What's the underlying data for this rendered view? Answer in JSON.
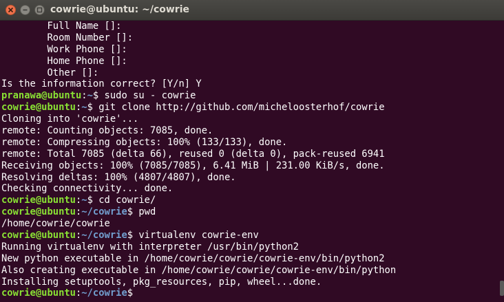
{
  "window": {
    "title": "cowrie@ubuntu: ~/cowrie",
    "buttons": [
      "close-icon",
      "minimize-icon",
      "maximize-icon"
    ]
  },
  "colors": {
    "background": "#300a24",
    "user": "#8ae234",
    "path": "#729fcf",
    "text": "#ffffff"
  },
  "terminal": {
    "lines": [
      {
        "text": "        Full Name []:"
      },
      {
        "text": "        Room Number []:"
      },
      {
        "text": "        Work Phone []:"
      },
      {
        "text": "        Home Phone []:"
      },
      {
        "text": "        Other []:"
      },
      {
        "text": "Is the information correct? [Y/n] Y"
      },
      {
        "user": "pranawa@ubuntu",
        "path": "~",
        "cmd": "$ sudo su - cowrie"
      },
      {
        "user": "cowrie@ubuntu",
        "path": "~",
        "cmd": "$ git clone http://github.com/micheloosterhof/cowrie"
      },
      {
        "text": "Cloning into 'cowrie'..."
      },
      {
        "text": "remote: Counting objects: 7085, done."
      },
      {
        "text": "remote: Compressing objects: 100% (133/133), done."
      },
      {
        "text": "remote: Total 7085 (delta 66), reused 0 (delta 0), pack-reused 6941"
      },
      {
        "text": "Receiving objects: 100% (7085/7085), 6.41 MiB | 231.00 KiB/s, done."
      },
      {
        "text": "Resolving deltas: 100% (4807/4807), done."
      },
      {
        "text": "Checking connectivity... done."
      },
      {
        "user": "cowrie@ubuntu",
        "path": "~",
        "cmd": "$ cd cowrie/"
      },
      {
        "user": "cowrie@ubuntu",
        "path": "~/cowrie",
        "cmd": "$ pwd"
      },
      {
        "text": "/home/cowrie/cowrie"
      },
      {
        "user": "cowrie@ubuntu",
        "path": "~/cowrie",
        "cmd": "$ virtualenv cowrie-env"
      },
      {
        "text": "Running virtualenv with interpreter /usr/bin/python2"
      },
      {
        "text": "New python executable in /home/cowrie/cowrie/cowrie-env/bin/python2"
      },
      {
        "text": "Also creating executable in /home/cowrie/cowrie/cowrie-env/bin/python"
      },
      {
        "text": "Installing setuptools, pkg_resources, pip, wheel...done."
      },
      {
        "user": "cowrie@ubuntu",
        "path": "~/cowrie",
        "cmd": "$ "
      }
    ]
  }
}
